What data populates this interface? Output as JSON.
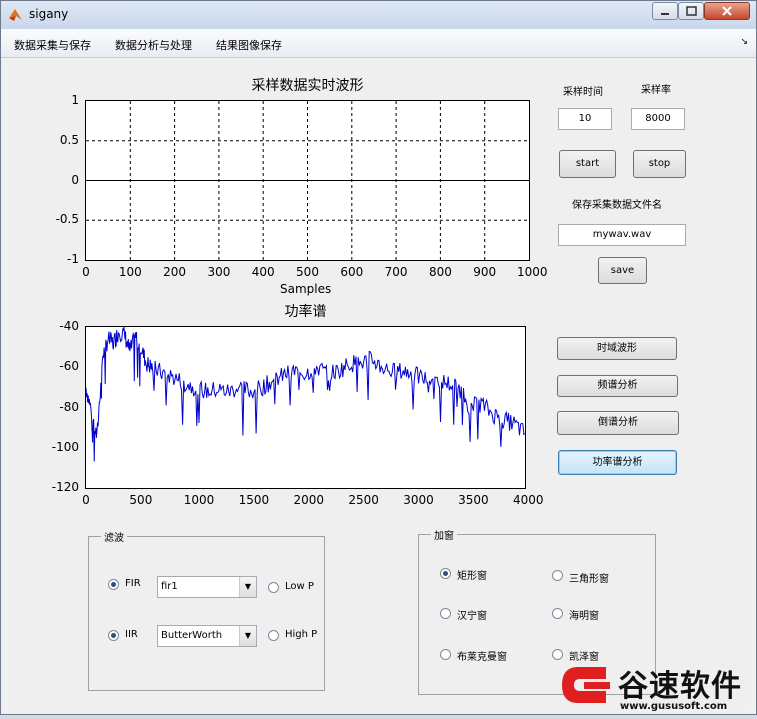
{
  "window": {
    "title": "sigany"
  },
  "menubar": {
    "items": [
      "数据采集与保存",
      "数据分析与处理",
      "结果图像保存"
    ]
  },
  "plot1": {
    "title": "采样数据实时波形",
    "xlabel": "Samples",
    "xticks": [
      "0",
      "100",
      "200",
      "300",
      "400",
      "500",
      "600",
      "700",
      "800",
      "900",
      "1000"
    ],
    "yticks": [
      "1",
      "0.5",
      "0",
      "-0.5",
      "-1"
    ]
  },
  "plot2": {
    "title": "功率谱",
    "xticks": [
      "0",
      "500",
      "1000",
      "1500",
      "2000",
      "2500",
      "3000",
      "3500",
      "4000"
    ],
    "yticks": [
      "-40",
      "-60",
      "-80",
      "-100",
      "-120"
    ]
  },
  "chart_data": [
    {
      "type": "line",
      "title": "采样数据实时波形",
      "xlabel": "Samples",
      "ylabel": "",
      "xlim": [
        0,
        1000
      ],
      "ylim": [
        -1,
        1
      ],
      "grid": true,
      "series": [
        {
          "x": [
            0,
            1000
          ],
          "y": [
            0,
            0
          ]
        }
      ]
    },
    {
      "type": "line",
      "title": "功率谱",
      "xlim": [
        0,
        4000
      ],
      "ylim": [
        -120,
        -40
      ],
      "grid": false,
      "color": "#0000cc",
      "series": [
        {
          "x": [
            0,
            50,
            100,
            150,
            200,
            250,
            300,
            350,
            400,
            450,
            500,
            550,
            600,
            700,
            800,
            900,
            1000,
            1100,
            1200,
            1300,
            1400,
            1500,
            1600,
            1700,
            1800,
            1900,
            2000,
            2100,
            2200,
            2300,
            2400,
            2500,
            2600,
            2700,
            2800,
            2900,
            3000,
            3100,
            3200,
            3300,
            3400,
            3500,
            3600,
            3700,
            3800,
            3900,
            4000
          ],
          "y": [
            -70,
            -82,
            -95,
            -55,
            -46,
            -48,
            -42,
            -44,
            -52,
            -45,
            -50,
            -58,
            -60,
            -63,
            -65,
            -68,
            -70,
            -72,
            -71,
            -72,
            -70,
            -72,
            -70,
            -67,
            -64,
            -62,
            -63,
            -60,
            -63,
            -62,
            -58,
            -58,
            -56,
            -60,
            -62,
            -62,
            -64,
            -66,
            -66,
            -68,
            -70,
            -80,
            -78,
            -83,
            -86,
            -88,
            -93
          ]
        }
      ]
    }
  ],
  "controls": {
    "time_label": "采样时间",
    "rate_label": "采样率",
    "time_value": "10",
    "rate_value": "8000",
    "start": "start",
    "stop": "stop",
    "filename_label": "保存采集数据文件名",
    "filename_value": "mywav.wav",
    "save": "save",
    "btn_time": "时域波形",
    "btn_freq": "频谱分析",
    "btn_cep": "倒谱分析",
    "btn_psd": "功率谱分析"
  },
  "filter_panel": {
    "title": "滤波",
    "fir_label": "FIR",
    "fir_select": "fir1",
    "iir_label": "IIR",
    "iir_select": "ButterWorth",
    "lowpass": "Low P",
    "highpass": "High P"
  },
  "window_panel": {
    "title": "加窗",
    "rect": "矩形窗",
    "tri": "三角形窗",
    "hann": "汉宁窗",
    "hamming": "海明窗",
    "blackman": "布莱克曼窗",
    "kaiser": "凯泽窗"
  },
  "logo": {
    "text": "谷速软件",
    "url": "www.gususoft.com",
    "brand_color": "#e02020"
  }
}
